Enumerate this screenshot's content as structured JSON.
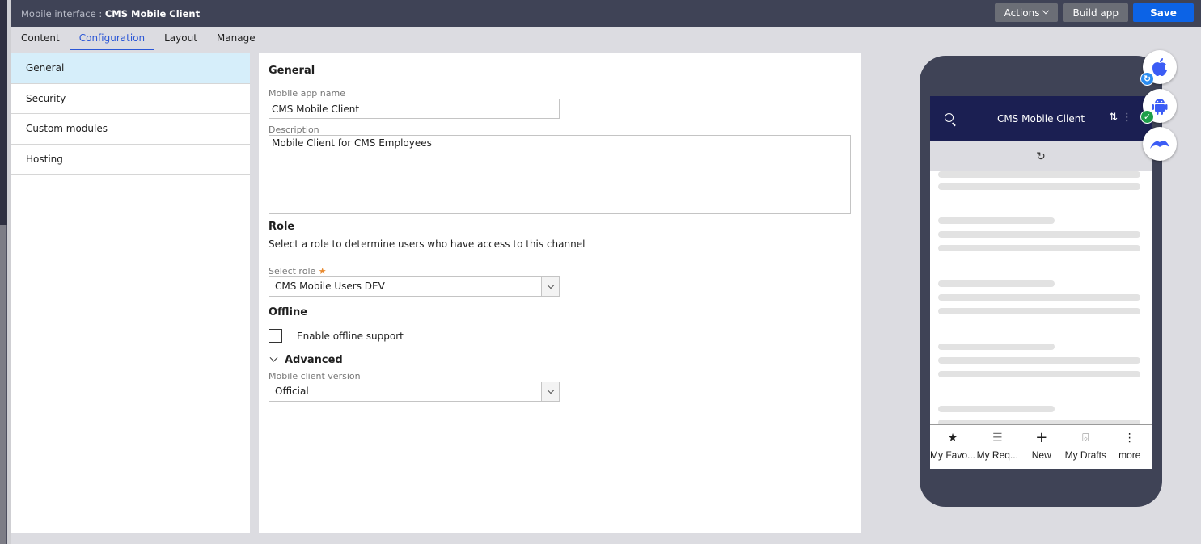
{
  "header": {
    "prefix": "Mobile interface :",
    "title": "CMS Mobile Client",
    "actions_label": "Actions",
    "build_label": "Build app",
    "save_label": "Save"
  },
  "tabs": [
    {
      "label": "Content",
      "active": false
    },
    {
      "label": "Configuration",
      "active": true
    },
    {
      "label": "Layout",
      "active": false
    },
    {
      "label": "Manage",
      "active": false
    }
  ],
  "sidebar": {
    "items": [
      {
        "label": "General",
        "active": true
      },
      {
        "label": "Security",
        "active": false
      },
      {
        "label": "Custom modules",
        "active": false
      },
      {
        "label": "Hosting",
        "active": false
      }
    ]
  },
  "form": {
    "general_heading": "General",
    "app_name_label": "Mobile app name",
    "app_name_value": "CMS Mobile Client",
    "description_label": "Description",
    "description_value": "Mobile Client for CMS Employees",
    "role_heading": "Role",
    "role_help": "Select a role to determine users who have access to this channel",
    "select_role_label": "Select role",
    "required_mark": "★",
    "select_role_value": "CMS Mobile Users DEV",
    "offline_heading": "Offline",
    "offline_checkbox_label": "Enable offline support",
    "offline_checked": false,
    "advanced_label": "Advanced",
    "client_version_label": "Mobile client version",
    "client_version_value": "Official"
  },
  "preview": {
    "app_title": "CMS Mobile Client",
    "nav": [
      {
        "icon": "★",
        "label": "My Favo..."
      },
      {
        "icon": "☰",
        "label": "My Req..."
      },
      {
        "icon": "+",
        "label": "New"
      },
      {
        "icon": "⌺",
        "label": "My Drafts"
      },
      {
        "icon": "⋮",
        "label": "more"
      }
    ],
    "platforms": [
      {
        "name": "iOS",
        "status": "refreshing"
      },
      {
        "name": "Android",
        "status": "ready"
      },
      {
        "name": "Pega",
        "status": "none"
      }
    ],
    "colors": {
      "app_header": "#1b1f52",
      "status_refresh": "#2a8cf0",
      "status_ok": "#1e9e4a",
      "platform_icon": "#3b5cf5"
    }
  }
}
